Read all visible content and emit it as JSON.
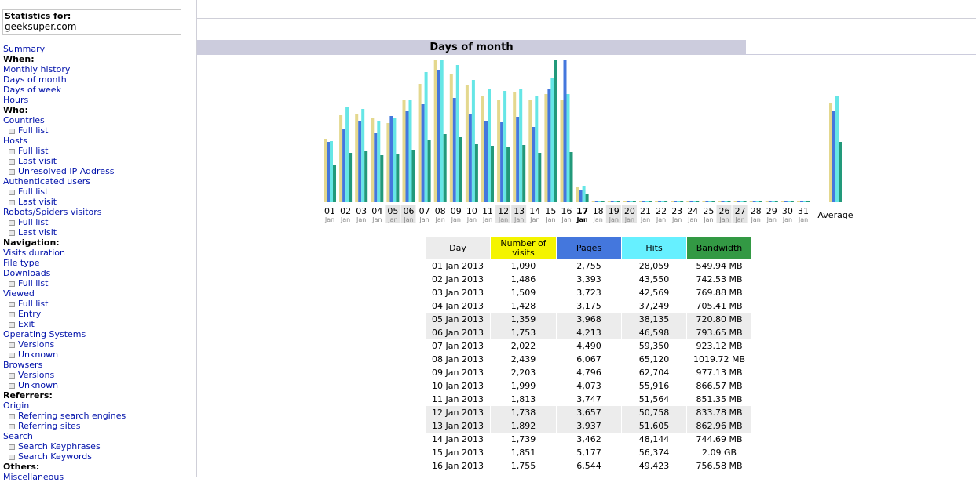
{
  "stats": {
    "label": "Statistics for:",
    "site": "geeksuper.com"
  },
  "menu": [
    {
      "type": "link",
      "text": "Summary"
    },
    {
      "type": "head",
      "text": "When:"
    },
    {
      "type": "link",
      "text": "Monthly history"
    },
    {
      "type": "link",
      "text": "Days of month"
    },
    {
      "type": "link",
      "text": "Days of week"
    },
    {
      "type": "link",
      "text": "Hours"
    },
    {
      "type": "head",
      "text": "Who:"
    },
    {
      "type": "link",
      "text": "Countries"
    },
    {
      "type": "sub",
      "text": "Full list"
    },
    {
      "type": "link",
      "text": "Hosts"
    },
    {
      "type": "sub",
      "text": "Full list"
    },
    {
      "type": "sub",
      "text": "Last visit"
    },
    {
      "type": "sub",
      "text": "Unresolved IP Address"
    },
    {
      "type": "link",
      "text": "Authenticated users"
    },
    {
      "type": "sub",
      "text": "Full list"
    },
    {
      "type": "sub",
      "text": "Last visit"
    },
    {
      "type": "link",
      "text": "Robots/Spiders visitors"
    },
    {
      "type": "sub",
      "text": "Full list"
    },
    {
      "type": "sub",
      "text": "Last visit"
    },
    {
      "type": "head",
      "text": "Navigation:"
    },
    {
      "type": "link",
      "text": "Visits duration"
    },
    {
      "type": "link",
      "text": "File type"
    },
    {
      "type": "link",
      "text": "Downloads"
    },
    {
      "type": "sub",
      "text": "Full list"
    },
    {
      "type": "link",
      "text": "Viewed"
    },
    {
      "type": "sub",
      "text": "Full list"
    },
    {
      "type": "sub",
      "text": "Entry"
    },
    {
      "type": "sub",
      "text": "Exit"
    },
    {
      "type": "link",
      "text": "Operating Systems"
    },
    {
      "type": "sub",
      "text": "Versions"
    },
    {
      "type": "sub",
      "text": "Unknown"
    },
    {
      "type": "link",
      "text": "Browsers"
    },
    {
      "type": "sub",
      "text": "Versions"
    },
    {
      "type": "sub",
      "text": "Unknown"
    },
    {
      "type": "head",
      "text": "Referrers:"
    },
    {
      "type": "link",
      "text": "Origin"
    },
    {
      "type": "sub",
      "text": "Referring search engines"
    },
    {
      "type": "sub",
      "text": "Referring sites"
    },
    {
      "type": "link",
      "text": "Search"
    },
    {
      "type": "sub",
      "text": "Search Keyphrases"
    },
    {
      "type": "sub",
      "text": "Search Keywords"
    },
    {
      "type": "head",
      "text": "Others:"
    },
    {
      "type": "link",
      "text": "Miscellaneous"
    }
  ],
  "section": {
    "title": "Days of month"
  },
  "table": {
    "headers": [
      "Day",
      "Number of visits",
      "Pages",
      "Hits",
      "Bandwidth"
    ],
    "header_colors": [
      "#ececec",
      "#f4f400",
      "#4477dd",
      "#66f0ff",
      "#339944"
    ],
    "rows": [
      {
        "day": "01 Jan 2013",
        "visits": "1,090",
        "pages": "2,755",
        "hits": "28,059",
        "bw": "549.94 MB",
        "weekend": false
      },
      {
        "day": "02 Jan 2013",
        "visits": "1,486",
        "pages": "3,393",
        "hits": "43,550",
        "bw": "742.53 MB",
        "weekend": false
      },
      {
        "day": "03 Jan 2013",
        "visits": "1,509",
        "pages": "3,723",
        "hits": "42,569",
        "bw": "769.88 MB",
        "weekend": false
      },
      {
        "day": "04 Jan 2013",
        "visits": "1,428",
        "pages": "3,175",
        "hits": "37,249",
        "bw": "705.41 MB",
        "weekend": false
      },
      {
        "day": "05 Jan 2013",
        "visits": "1,359",
        "pages": "3,968",
        "hits": "38,135",
        "bw": "720.80 MB",
        "weekend": true
      },
      {
        "day": "06 Jan 2013",
        "visits": "1,753",
        "pages": "4,213",
        "hits": "46,598",
        "bw": "793.65 MB",
        "weekend": true
      },
      {
        "day": "07 Jan 2013",
        "visits": "2,022",
        "pages": "4,490",
        "hits": "59,350",
        "bw": "923.12 MB",
        "weekend": false
      },
      {
        "day": "08 Jan 2013",
        "visits": "2,439",
        "pages": "6,067",
        "hits": "65,120",
        "bw": "1019.72 MB",
        "weekend": false
      },
      {
        "day": "09 Jan 2013",
        "visits": "2,203",
        "pages": "4,796",
        "hits": "62,704",
        "bw": "977.13 MB",
        "weekend": false
      },
      {
        "day": "10 Jan 2013",
        "visits": "1,999",
        "pages": "4,073",
        "hits": "55,916",
        "bw": "866.57 MB",
        "weekend": false
      },
      {
        "day": "11 Jan 2013",
        "visits": "1,813",
        "pages": "3,747",
        "hits": "51,564",
        "bw": "851.35 MB",
        "weekend": false
      },
      {
        "day": "12 Jan 2013",
        "visits": "1,738",
        "pages": "3,657",
        "hits": "50,758",
        "bw": "833.78 MB",
        "weekend": true
      },
      {
        "day": "13 Jan 2013",
        "visits": "1,892",
        "pages": "3,937",
        "hits": "51,605",
        "bw": "862.96 MB",
        "weekend": true
      },
      {
        "day": "14 Jan 2013",
        "visits": "1,739",
        "pages": "3,462",
        "hits": "48,144",
        "bw": "744.69 MB",
        "weekend": false
      },
      {
        "day": "15 Jan 2013",
        "visits": "1,851",
        "pages": "5,177",
        "hits": "56,374",
        "bw": "2.09 GB",
        "weekend": false
      },
      {
        "day": "16 Jan 2013",
        "visits": "1,755",
        "pages": "6,544",
        "hits": "49,423",
        "bw": "756.58 MB",
        "weekend": false
      }
    ]
  },
  "chart_data": {
    "type": "bar",
    "colors": {
      "visits": "#e4d88e",
      "pages": "#4477dd",
      "hits": "#66e6e6",
      "bandwidth": "#22997a"
    },
    "days": [
      {
        "n": "01",
        "m": "Jan",
        "visits": 1090,
        "pages": 2755,
        "hits": 28059,
        "bw": 549.94,
        "weekend": false,
        "today": false
      },
      {
        "n": "02",
        "m": "Jan",
        "visits": 1486,
        "pages": 3393,
        "hits": 43550,
        "bw": 742.53,
        "weekend": false,
        "today": false
      },
      {
        "n": "03",
        "m": "Jan",
        "visits": 1509,
        "pages": 3723,
        "hits": 42569,
        "bw": 769.88,
        "weekend": false,
        "today": false
      },
      {
        "n": "04",
        "m": "Jan",
        "visits": 1428,
        "pages": 3175,
        "hits": 37249,
        "bw": 705.41,
        "weekend": false,
        "today": false
      },
      {
        "n": "05",
        "m": "Jan",
        "visits": 1359,
        "pages": 3968,
        "hits": 38135,
        "bw": 720.8,
        "weekend": true,
        "today": false
      },
      {
        "n": "06",
        "m": "Jan",
        "visits": 1753,
        "pages": 4213,
        "hits": 46598,
        "bw": 793.65,
        "weekend": true,
        "today": false
      },
      {
        "n": "07",
        "m": "Jan",
        "visits": 2022,
        "pages": 4490,
        "hits": 59350,
        "bw": 923.12,
        "weekend": false,
        "today": false
      },
      {
        "n": "08",
        "m": "Jan",
        "visits": 2439,
        "pages": 6067,
        "hits": 65120,
        "bw": 1019.72,
        "weekend": false,
        "today": false
      },
      {
        "n": "09",
        "m": "Jan",
        "visits": 2203,
        "pages": 4796,
        "hits": 62704,
        "bw": 977.13,
        "weekend": false,
        "today": false
      },
      {
        "n": "10",
        "m": "Jan",
        "visits": 1999,
        "pages": 4073,
        "hits": 55916,
        "bw": 866.57,
        "weekend": false,
        "today": false
      },
      {
        "n": "11",
        "m": "Jan",
        "visits": 1813,
        "pages": 3747,
        "hits": 51564,
        "bw": 851.35,
        "weekend": false,
        "today": false
      },
      {
        "n": "12",
        "m": "Jan",
        "visits": 1738,
        "pages": 3657,
        "hits": 50758,
        "bw": 833.78,
        "weekend": true,
        "today": false
      },
      {
        "n": "13",
        "m": "Jan",
        "visits": 1892,
        "pages": 3937,
        "hits": 51605,
        "bw": 862.96,
        "weekend": true,
        "today": false
      },
      {
        "n": "14",
        "m": "Jan",
        "visits": 1739,
        "pages": 3462,
        "hits": 48144,
        "bw": 744.69,
        "weekend": false,
        "today": false
      },
      {
        "n": "15",
        "m": "Jan",
        "visits": 1851,
        "pages": 5177,
        "hits": 56374,
        "bw": 2140.16,
        "weekend": false,
        "today": false
      },
      {
        "n": "16",
        "m": "Jan",
        "visits": 1755,
        "pages": 6544,
        "hits": 49423,
        "bw": 756.58,
        "weekend": false,
        "today": false
      },
      {
        "n": "17",
        "m": "Jan",
        "visits": 250,
        "pages": 560,
        "hits": 7400,
        "bw": 120,
        "weekend": false,
        "today": true
      },
      {
        "n": "18",
        "m": "Jan",
        "visits": 0,
        "pages": 0,
        "hits": 0,
        "bw": 0,
        "weekend": false,
        "today": false
      },
      {
        "n": "19",
        "m": "Jan",
        "visits": 0,
        "pages": 0,
        "hits": 0,
        "bw": 0,
        "weekend": true,
        "today": false
      },
      {
        "n": "20",
        "m": "Jan",
        "visits": 0,
        "pages": 0,
        "hits": 0,
        "bw": 0,
        "weekend": true,
        "today": false
      },
      {
        "n": "21",
        "m": "Jan",
        "visits": 0,
        "pages": 0,
        "hits": 0,
        "bw": 0,
        "weekend": false,
        "today": false
      },
      {
        "n": "22",
        "m": "Jan",
        "visits": 0,
        "pages": 0,
        "hits": 0,
        "bw": 0,
        "weekend": false,
        "today": false
      },
      {
        "n": "23",
        "m": "Jan",
        "visits": 0,
        "pages": 0,
        "hits": 0,
        "bw": 0,
        "weekend": false,
        "today": false
      },
      {
        "n": "24",
        "m": "Jan",
        "visits": 0,
        "pages": 0,
        "hits": 0,
        "bw": 0,
        "weekend": false,
        "today": false
      },
      {
        "n": "25",
        "m": "Jan",
        "visits": 0,
        "pages": 0,
        "hits": 0,
        "bw": 0,
        "weekend": false,
        "today": false
      },
      {
        "n": "26",
        "m": "Jan",
        "visits": 0,
        "pages": 0,
        "hits": 0,
        "bw": 0,
        "weekend": true,
        "today": false
      },
      {
        "n": "27",
        "m": "Jan",
        "visits": 0,
        "pages": 0,
        "hits": 0,
        "bw": 0,
        "weekend": true,
        "today": false
      },
      {
        "n": "28",
        "m": "Jan",
        "visits": 0,
        "pages": 0,
        "hits": 0,
        "bw": 0,
        "weekend": false,
        "today": false
      },
      {
        "n": "29",
        "m": "Jan",
        "visits": 0,
        "pages": 0,
        "hits": 0,
        "bw": 0,
        "weekend": false,
        "today": false
      },
      {
        "n": "30",
        "m": "Jan",
        "visits": 0,
        "pages": 0,
        "hits": 0,
        "bw": 0,
        "weekend": false,
        "today": false
      },
      {
        "n": "31",
        "m": "Jan",
        "visits": 0,
        "pages": 0,
        "hits": 0,
        "bw": 0,
        "weekend": false,
        "today": false
      }
    ],
    "average": {
      "label": "Average",
      "visits": 1700,
      "pages": 4200,
      "hits": 48500,
      "bw": 900
    }
  }
}
